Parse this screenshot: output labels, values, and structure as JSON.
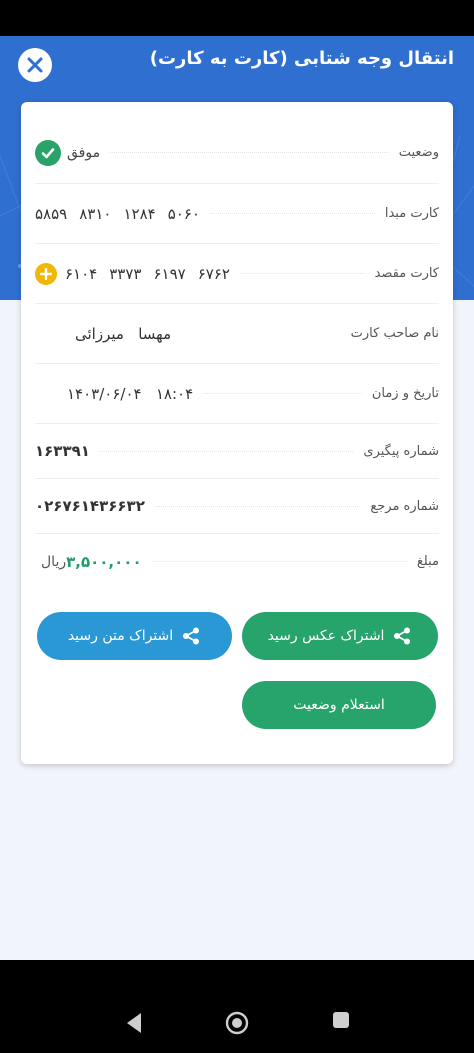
{
  "header": {
    "title": "انتقال وجه شتابی (کارت به کارت)"
  },
  "receipt": {
    "rows": [
      {
        "label": "وضعیت",
        "value": "موفق"
      },
      {
        "label": "کارت مبدا",
        "value": [
          "۵۸۵۹",
          "۸۳۱۰",
          "۱۲۸۴",
          "۵۰۶۰"
        ]
      },
      {
        "label": "کارت مقصد",
        "value": [
          "۶۱۰۴",
          "۳۳۷۳",
          "۶۱۹۷",
          "۶۷۶۲"
        ]
      },
      {
        "label": "نام صاحب کارت",
        "value": "مهسا   میرزائی"
      },
      {
        "label": "تاریخ و زمان",
        "value": "۱۴۰۳/۰۶/۰۴   ۱۸:۰۴"
      },
      {
        "label": "شماره پیگیری",
        "value": "۱۶۳۳۹۱"
      },
      {
        "label": "شماره مرجع",
        "value": "۰۲۶۷۶۱۴۳۶۶۳۲"
      },
      {
        "label": "مبلغ",
        "amount": "۳,۵۰۰,۰۰۰",
        "unit": "ریال"
      }
    ]
  },
  "actions": {
    "share_image": "اشتراک عکس رسید",
    "share_text": "اشتراک متن رسید",
    "inquiry": "استعلام وضعیت"
  },
  "colors": {
    "header": "#2f6fd0",
    "success": "#29a36a",
    "primary_button": "#27a36c",
    "secondary_button": "#2b98d6",
    "plus_badge": "#f2b705"
  },
  "icons": {
    "close": "close-icon",
    "status": "check-circle-icon",
    "dest_card": "plus-circle-icon",
    "share": "share-icon"
  }
}
